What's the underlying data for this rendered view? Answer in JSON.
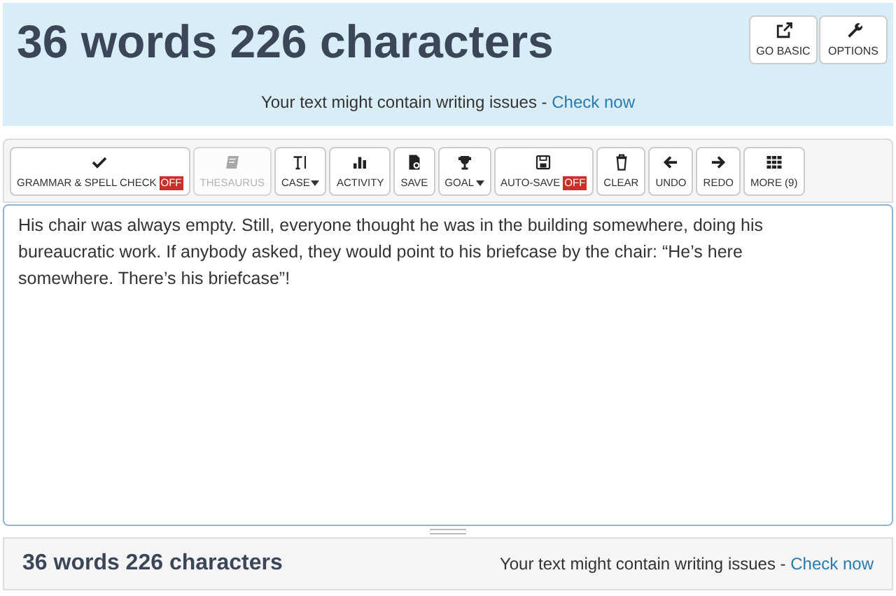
{
  "header": {
    "title": "36 words 226 characters",
    "buttons": [
      {
        "label": "GO BASIC"
      },
      {
        "label": "OPTIONS"
      }
    ],
    "message": "Your text might contain writing issues - ",
    "link": "Check now"
  },
  "toolbar": [
    {
      "label": "GRAMMAR & SPELL CHECK",
      "badge": "OFF",
      "disabled": false,
      "dropdown": false
    },
    {
      "label": "THESAURUS",
      "disabled": true,
      "dropdown": false
    },
    {
      "label": "CASE",
      "disabled": false,
      "dropdown": true
    },
    {
      "label": "ACTIVITY",
      "disabled": false,
      "dropdown": false
    },
    {
      "label": "SAVE",
      "disabled": false,
      "dropdown": false
    },
    {
      "label": "GOAL",
      "disabled": false,
      "dropdown": true
    },
    {
      "label": "AUTO-SAVE",
      "badge": "OFF",
      "disabled": false,
      "dropdown": false
    },
    {
      "label": "CLEAR",
      "disabled": false,
      "dropdown": false
    },
    {
      "label": "UNDO",
      "disabled": false,
      "dropdown": false
    },
    {
      "label": "REDO",
      "disabled": false,
      "dropdown": false
    },
    {
      "label": "MORE (9)",
      "disabled": false,
      "dropdown": false
    }
  ],
  "editor": {
    "value": "His chair was always empty. Still, everyone thought he was in the building somewhere, doing his bureaucratic work. If anybody asked, they would point to his briefcase by the chair: “He’s here somewhere. There’s his briefcase”!"
  },
  "footer": {
    "count": "36 words 226 characters",
    "message": "Your text might contain writing issues - ",
    "link": "Check now"
  }
}
